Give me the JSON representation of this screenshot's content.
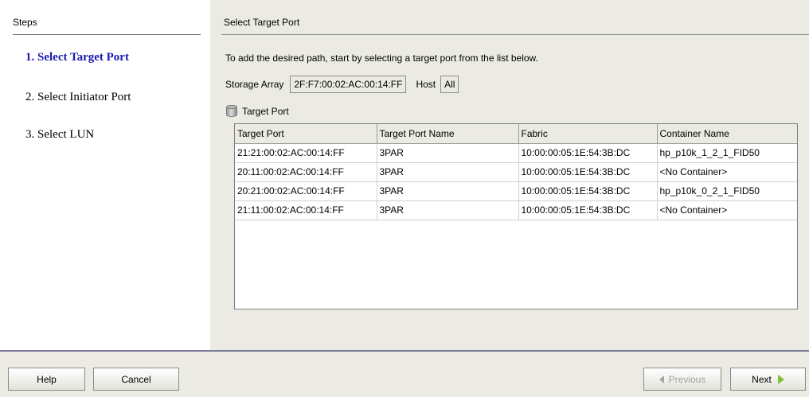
{
  "steps": {
    "header": "Steps",
    "items": [
      {
        "label": "1. Select Target Port",
        "active": true
      },
      {
        "label": "2. Select Initiator Port",
        "active": false
      },
      {
        "label": "3. Select LUN",
        "active": false
      }
    ]
  },
  "main": {
    "title": "Select Target Port",
    "instruction": "To add the desired path, start by selecting a target port from the list below.",
    "storage_array_label": "Storage Array",
    "storage_array_value": "2F:F7:00:02:AC:00:14:FF",
    "host_label": "Host",
    "host_value": "All",
    "table_title": "Target Port",
    "table_icon": "database-icon",
    "columns": [
      "Target Port",
      "Target Port Name",
      "Fabric",
      "Container Name"
    ],
    "rows": [
      [
        "21:21:00:02:AC:00:14:FF",
        "3PAR",
        "10:00:00:05:1E:54:3B:DC",
        "hp_p10k_1_2_1_FID50"
      ],
      [
        "20:11:00:02:AC:00:14:FF",
        "3PAR",
        "10:00:00:05:1E:54:3B:DC",
        "<No Container>"
      ],
      [
        "20:21:00:02:AC:00:14:FF",
        "3PAR",
        "10:00:00:05:1E:54:3B:DC",
        "hp_p10k_0_2_1_FID50"
      ],
      [
        "21:11:00:02:AC:00:14:FF",
        "3PAR",
        "10:00:00:05:1E:54:3B:DC",
        "<No Container>"
      ]
    ]
  },
  "footer": {
    "help_label": "Help",
    "cancel_label": "Cancel",
    "previous_label": "Previous",
    "next_label": "Next"
  },
  "colors": {
    "active_step": "#1a1ab3",
    "panel_bg": "#ecebe3",
    "next_arrow": "#7ec03a"
  }
}
